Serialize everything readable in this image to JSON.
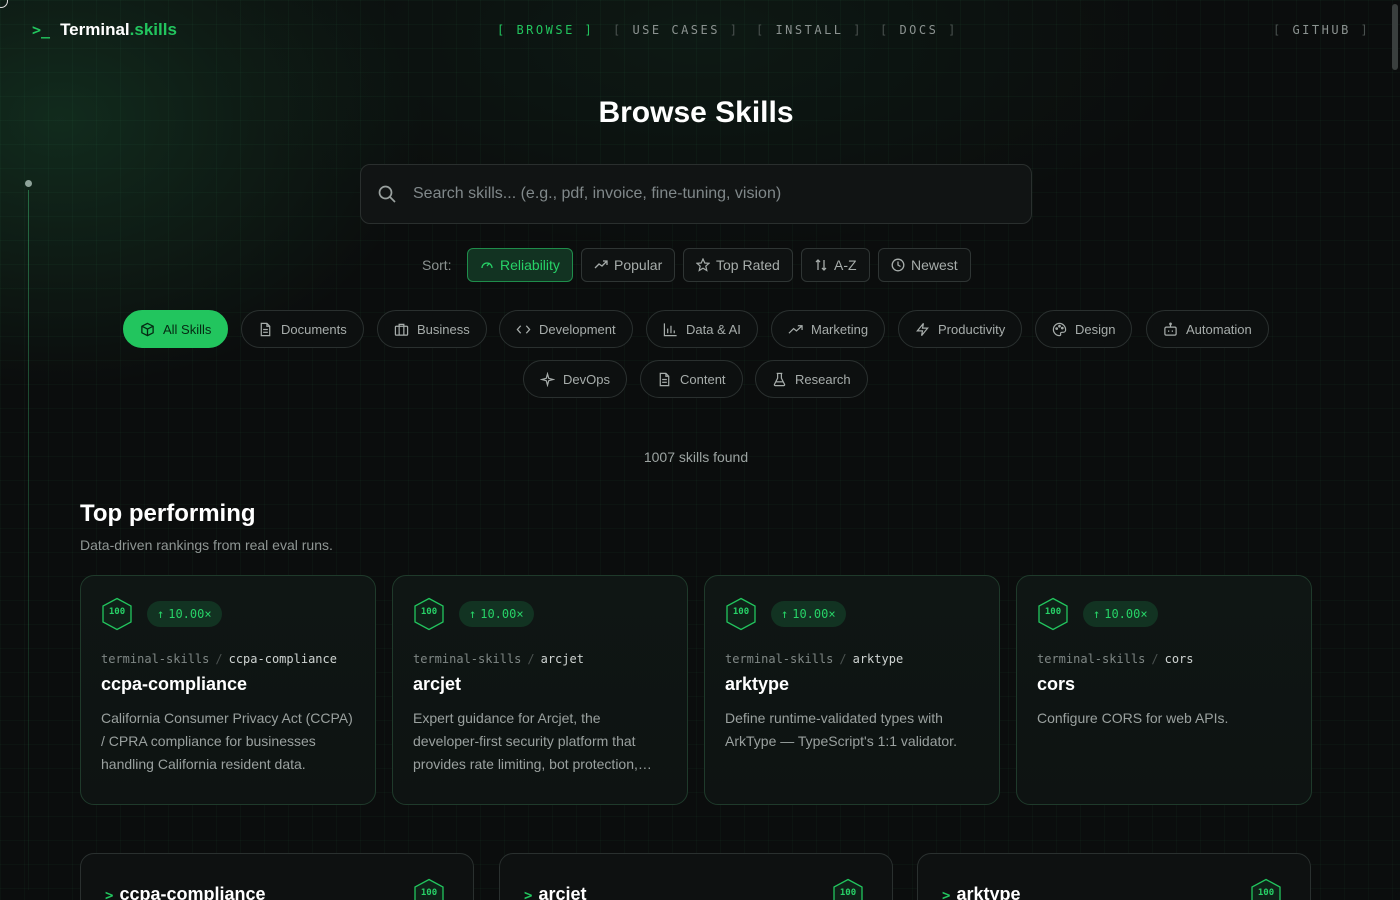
{
  "brand": {
    "prompt": ">_",
    "name": "Terminal",
    "suffix": ".skills"
  },
  "nav": {
    "items": [
      {
        "label": "BROWSE",
        "active": true
      },
      {
        "label": "USE CASES",
        "active": false
      },
      {
        "label": "INSTALL",
        "active": false
      },
      {
        "label": "DOCS",
        "active": false
      }
    ],
    "github": "GITHUB"
  },
  "page_title": "Browse Skills",
  "search": {
    "placeholder": "Search skills... (e.g., pdf, invoice, fine-tuning, vision)",
    "value": ""
  },
  "sort": {
    "label": "Sort:",
    "options": [
      {
        "label": "Reliability",
        "icon": "gauge-icon",
        "active": true
      },
      {
        "label": "Popular",
        "icon": "trending-icon",
        "active": false
      },
      {
        "label": "Top Rated",
        "icon": "star-icon",
        "active": false
      },
      {
        "label": "A-Z",
        "icon": "sort-arrows-icon",
        "active": false
      },
      {
        "label": "Newest",
        "icon": "clock-icon",
        "active": false
      }
    ]
  },
  "categories": [
    {
      "label": "All Skills",
      "icon": "box-icon",
      "active": true
    },
    {
      "label": "Documents",
      "icon": "document-icon",
      "active": false
    },
    {
      "label": "Business",
      "icon": "briefcase-icon",
      "active": false
    },
    {
      "label": "Development",
      "icon": "code-icon",
      "active": false
    },
    {
      "label": "Data & AI",
      "icon": "bar-chart-icon",
      "active": false
    },
    {
      "label": "Marketing",
      "icon": "trending-icon",
      "active": false
    },
    {
      "label": "Productivity",
      "icon": "lightning-icon",
      "active": false
    },
    {
      "label": "Design",
      "icon": "palette-icon",
      "active": false
    },
    {
      "label": "Automation",
      "icon": "robot-icon",
      "active": false
    },
    {
      "label": "DevOps",
      "icon": "sparkle-icon",
      "active": false
    },
    {
      "label": "Content",
      "icon": "document-icon",
      "active": false
    },
    {
      "label": "Research",
      "icon": "flask-icon",
      "active": false
    }
  ],
  "skills_found": "1007 skills found",
  "top_performing": {
    "title": "Top performing",
    "subtitle": "Data-driven rankings from real eval runs.",
    "cards": [
      {
        "score": "100",
        "multiplier": "10.00×",
        "org": "terminal-skills",
        "slug": "ccpa-compliance",
        "name": "ccpa-compliance",
        "description": "California Consumer Privacy Act (CCPA) / CPRA compliance for businesses handling California resident data."
      },
      {
        "score": "100",
        "multiplier": "10.00×",
        "org": "terminal-skills",
        "slug": "arcjet",
        "name": "arcjet",
        "description": "Expert guidance for Arcjet, the developer-first security platform that provides rate limiting, bot protection, email validation and more."
      },
      {
        "score": "100",
        "multiplier": "10.00×",
        "org": "terminal-skills",
        "slug": "arktype",
        "name": "arktype",
        "description": "Define runtime-validated types with ArkType — TypeScript's 1:1 validator."
      },
      {
        "score": "100",
        "multiplier": "10.00×",
        "org": "terminal-skills",
        "slug": "cors",
        "name": "cors",
        "description": "Configure CORS for web APIs."
      }
    ]
  },
  "list_cards": [
    {
      "name": "ccpa-compliance",
      "score": "100"
    },
    {
      "name": "arcjet",
      "score": "100"
    },
    {
      "name": "arktype",
      "score": "100"
    }
  ],
  "colors": {
    "accent": "#22c55e",
    "background": "#0b0d0d"
  }
}
